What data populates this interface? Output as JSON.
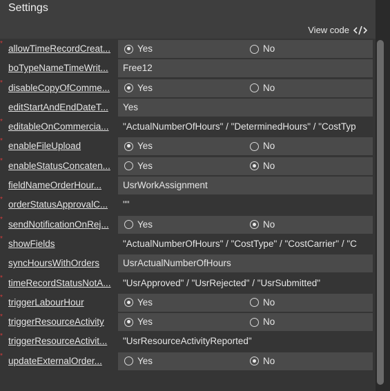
{
  "header": {
    "title": "Settings"
  },
  "toolbar": {
    "view_code_label": "View code",
    "view_code_icon": "code-icon"
  },
  "rows": [
    {
      "label": "allowTimeRecordCreat...",
      "type": "radio",
      "options": [
        "Yes",
        "No"
      ],
      "selected": "Yes",
      "required": true
    },
    {
      "label": "boTypeNameTimeWrit...",
      "type": "text",
      "value": "Free12",
      "required": false
    },
    {
      "label": "disableCopyOfComme...",
      "type": "radio",
      "options": [
        "Yes",
        "No"
      ],
      "selected": "Yes",
      "required": true
    },
    {
      "label": "editStartAndEndDateT...",
      "type": "text",
      "value": "Yes",
      "required": false
    },
    {
      "label": "editableOnCommercia...",
      "type": "text",
      "value": "\"ActualNumberOfHours\" / \"DeterminedHours\" / \"CostTyp",
      "required": true
    },
    {
      "label": "enableFileUpload",
      "type": "radio",
      "options": [
        "Yes",
        "No"
      ],
      "selected": "Yes",
      "required": true
    },
    {
      "label": "enableStatusConcaten...",
      "type": "radio",
      "options": [
        "Yes",
        "No"
      ],
      "selected": "No",
      "required": true
    },
    {
      "label": "fieldNameOrderHour...",
      "type": "text",
      "value": "UsrWorkAssignment",
      "required": false
    },
    {
      "label": "orderStatusApprovalC...",
      "type": "text",
      "value": "\"\"",
      "required": true
    },
    {
      "label": "sendNotificationOnRej...",
      "type": "radio",
      "options": [
        "Yes",
        "No"
      ],
      "selected": "No",
      "required": true
    },
    {
      "label": "showFields",
      "type": "text",
      "value": "\"ActualNumberOfHours\" / \"CostType\" / \"CostCarrier\" / \"C",
      "required": true
    },
    {
      "label": "syncHoursWithOrders",
      "type": "text",
      "value": "UsrActualNumberOfHours",
      "required": false
    },
    {
      "label": "timeRecordStatusNotA...",
      "type": "text",
      "value": "\"UsrApproved\" / \"UsrRejected\" / \"UsrSubmitted\"",
      "required": true
    },
    {
      "label": "triggerLabourHour",
      "type": "radio",
      "options": [
        "Yes",
        "No"
      ],
      "selected": "Yes",
      "required": true
    },
    {
      "label": "triggerResourceActivity",
      "type": "radio",
      "options": [
        "Yes",
        "No"
      ],
      "selected": "Yes",
      "required": true
    },
    {
      "label": "triggerResourceActivit...",
      "type": "text",
      "value": "\"UsrResourceActivityReported\"",
      "required": true
    },
    {
      "label": "updateExternalOrder...",
      "type": "radio",
      "options": [
        "Yes",
        "No"
      ],
      "selected": "No",
      "required": true
    }
  ]
}
